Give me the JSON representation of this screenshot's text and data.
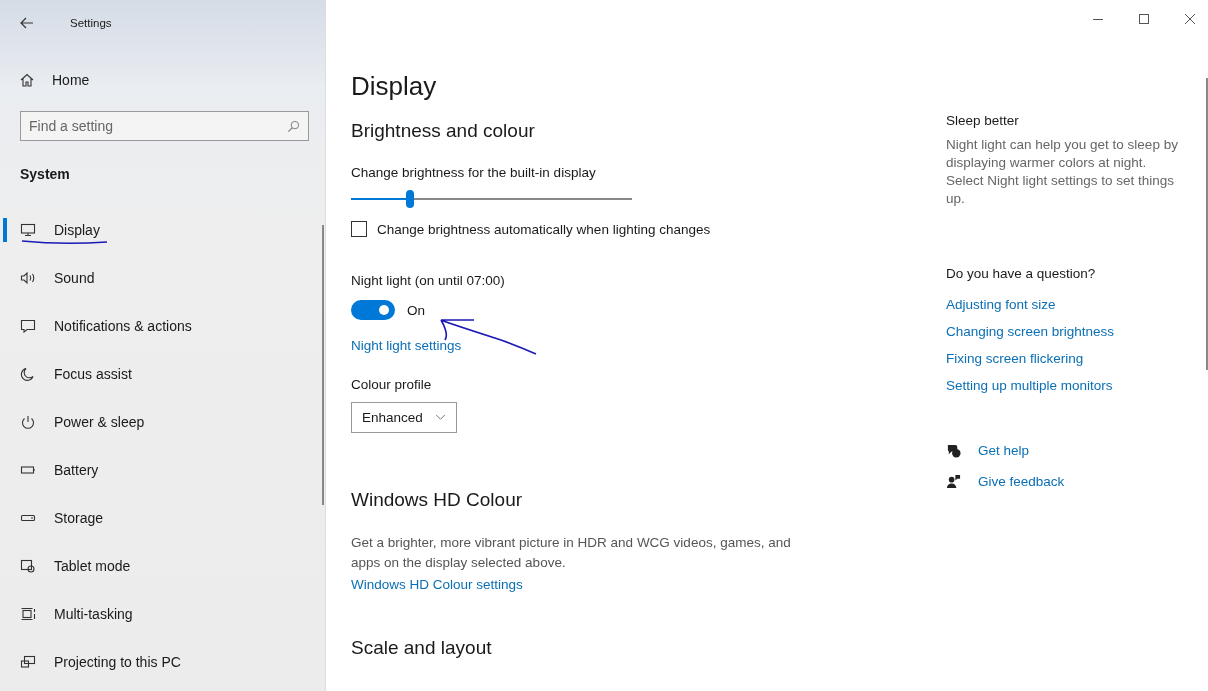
{
  "window": {
    "title": "Settings"
  },
  "sidebar": {
    "home": "Home",
    "search": {
      "placeholder": "Find a setting"
    },
    "section": "System",
    "items": [
      {
        "label": "Display",
        "selected": true
      },
      {
        "label": "Sound",
        "selected": false
      },
      {
        "label": "Notifications & actions",
        "selected": false
      },
      {
        "label": "Focus assist",
        "selected": false
      },
      {
        "label": "Power & sleep",
        "selected": false
      },
      {
        "label": "Battery",
        "selected": false
      },
      {
        "label": "Storage",
        "selected": false
      },
      {
        "label": "Tablet mode",
        "selected": false
      },
      {
        "label": "Multi-tasking",
        "selected": false
      },
      {
        "label": "Projecting to this PC",
        "selected": false
      }
    ]
  },
  "main": {
    "title": "Display",
    "brightness": {
      "heading": "Brightness and colour",
      "slider_label": "Change brightness for the built-in display",
      "level": 0.21,
      "auto_checkbox": {
        "label": "Change brightness automatically when lighting changes",
        "checked": false
      },
      "night_light": {
        "label": "Night light (on until 07:00)",
        "on": true,
        "state_text": "On",
        "link": "Night light settings"
      },
      "colour_profile": {
        "label": "Colour profile",
        "value": "Enhanced"
      }
    },
    "hd_colour": {
      "heading": "Windows HD Colour",
      "description": "Get a brighter, more vibrant picture in HDR and WCG videos, games, and apps on the display selected above.",
      "link": "Windows HD Colour settings"
    },
    "scale": {
      "heading": "Scale and layout"
    }
  },
  "aside": {
    "sleep_heading": "Sleep better",
    "sleep_text": "Night light can help you get to sleep by displaying warmer colors at night. Select Night light settings to set things up.",
    "question_heading": "Do you have a question?",
    "links": [
      "Adjusting font size",
      "Changing screen brightness",
      "Fixing screen flickering",
      "Setting up multiple monitors"
    ],
    "get_help": "Get help",
    "give_feedback": "Give feedback"
  }
}
